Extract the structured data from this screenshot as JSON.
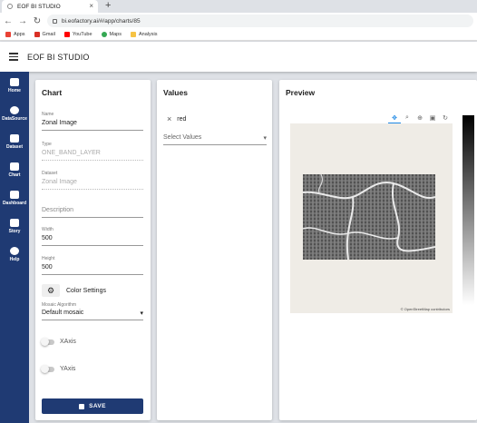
{
  "browser": {
    "tab_title": "EOF BI STUDIO",
    "new_tab": "+",
    "url": "bi.eofactory.ai/#/app/charts/85",
    "bookmarks": [
      "Apps",
      "Gmail",
      "YouTube",
      "Maps",
      "Analysis"
    ]
  },
  "app": {
    "title": "EOF BI STUDIO"
  },
  "sidebar": {
    "items": [
      {
        "label": "Home"
      },
      {
        "label": "DataSource"
      },
      {
        "label": "Dataset"
      },
      {
        "label": "Chart"
      },
      {
        "label": "Dashboard"
      },
      {
        "label": "Story"
      },
      {
        "label": "Help"
      }
    ]
  },
  "chart_panel": {
    "title": "Chart",
    "name": {
      "label": "Name",
      "value": "Zonal Image"
    },
    "type": {
      "label": "Type",
      "value": "ONE_BAND_LAYER"
    },
    "dataset": {
      "label": "Dataset",
      "value": "Zonal Image"
    },
    "description": {
      "placeholder": "Description"
    },
    "width": {
      "label": "Width",
      "value": "500"
    },
    "height": {
      "label": "Height",
      "value": "500"
    },
    "color_settings": "Color Settings",
    "mosaic": {
      "label": "Mosaic Algorithm",
      "value": "Default mosaic"
    },
    "xaxis": "XAxis",
    "yaxis": "YAxis",
    "save": "SAVE"
  },
  "values_panel": {
    "title": "Values",
    "chip": "red",
    "select_placeholder": "Select Values"
  },
  "preview_panel": {
    "title": "Preview",
    "attribution": "© OpenStreetMap contributors"
  }
}
